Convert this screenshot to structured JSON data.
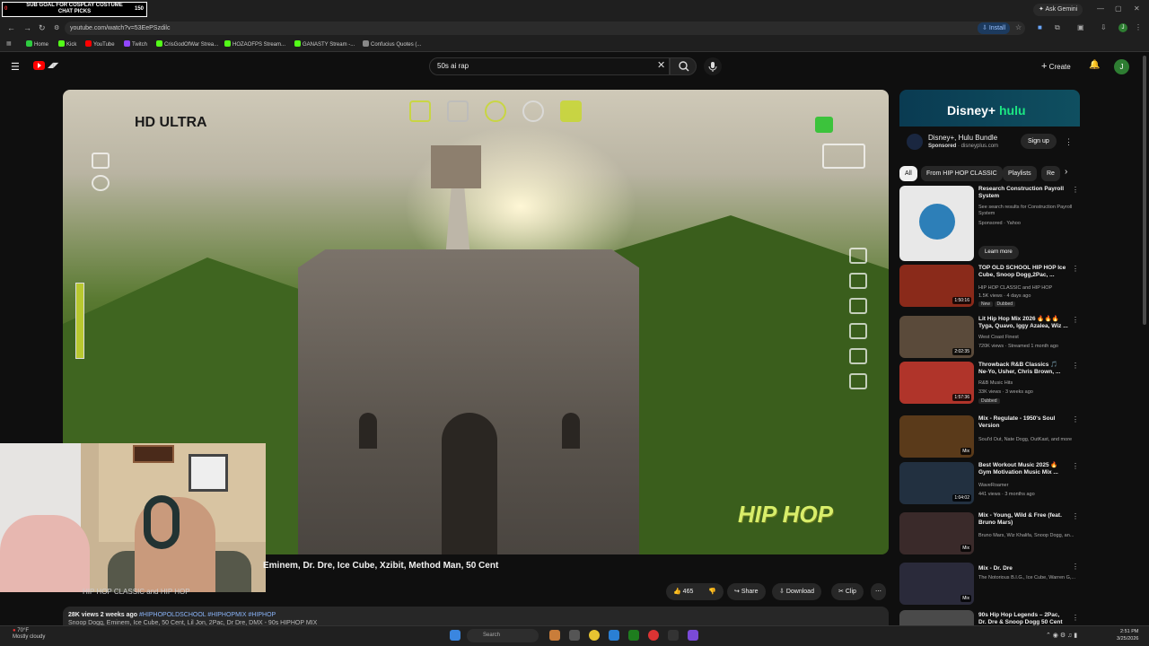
{
  "overlay": {
    "goal_line1": "SUB GOAL FOR COSPLAY COSTUME",
    "goal_line2": "CHAT PICKS",
    "goal_count": "150",
    "goal_live": "0"
  },
  "browser": {
    "ask_gemini": "Ask Gemini",
    "url": "youtube.com/watch?v=53EePSzdilc",
    "install": "Install",
    "bookmarks": [
      {
        "label": "Home",
        "color": "#2ecc40"
      },
      {
        "label": "Kick",
        "color": "#53fc18"
      },
      {
        "label": "YouTube",
        "color": "#ff0000"
      },
      {
        "label": "Twitch",
        "color": "#9146ff"
      },
      {
        "label": "CrisGodOfWar Strea...",
        "color": "#53fc18"
      },
      {
        "label": "HOZAOFPS Stream...",
        "color": "#53fc18"
      },
      {
        "label": "GANASTY Stream -...",
        "color": "#53fc18"
      },
      {
        "label": "Confucius Quotes (...",
        "color": "#888888"
      }
    ]
  },
  "youtube": {
    "search_value": "50s ai rap",
    "create": "Create",
    "avatar_letter": "J"
  },
  "player": {
    "hd_hd": "HD",
    "hd_ultra": " ULTRA",
    "overlay_text": "HIP HOP"
  },
  "video": {
    "title": "Eminem, Dr. Dre, Ice Cube, Xzibit, Method Man, 50 Cent",
    "channel": "HIP HOP CLASSIC and HIP HOP",
    "likes": "465",
    "share": "Share",
    "download": "Download",
    "clip": "Clip",
    "stats": "28K views  2 weeks ago",
    "tags": "#HIPHOPOLDSCHOOL #HIPHOPMIX #HIPHOP",
    "desc": "Snoop Dogg, Eminem, Ice Cube, 50 Cent, Lil Jon, 2Pac, Dr Dre, DMX - 90s HIPHOP MIX"
  },
  "sidebar": {
    "ad": {
      "banner_disney": "Disney+",
      "banner_hulu": " hulu",
      "title": "Disney+, Hulu Bundle",
      "sponsored": "Sponsored",
      "domain": " · disneyplus.com",
      "signup": "Sign up"
    },
    "chips": [
      "All",
      "From HIP HOP CLASSIC",
      "Playlists",
      "Re"
    ],
    "recs": [
      {
        "title": "Research Construction Payroll System",
        "line1": "See search results for Construction Payroll System",
        "line2": "Sponsored · Yahoo",
        "learn_more": "Learn more",
        "thumb": "#2d6b3a",
        "duration": ""
      },
      {
        "title": "TOP OLD SCHOOL HIP HOP Ice Cube, Snoop Dogg,2Pac, ...",
        "line1": "HIP HOP CLASSIC and HIP HOP",
        "line2": "1.5K views · 4 days ago",
        "badges": [
          "New",
          "Dubbed"
        ],
        "thumb": "#8a2a1a",
        "duration": "1:50:16"
      },
      {
        "title": "Lit Hip Hop Mix 2026 🔥🔥🔥 Tyga, Quavo, Iggy Azalea, Wiz ...",
        "line1": "West Coast Finest",
        "line2": "720K views · Streamed 1 month ago",
        "thumb": "#5a4a3a",
        "duration": "2:02:35"
      },
      {
        "title": "Throwback R&B Classics 🎵 Ne-Yo, Usher, Chris Brown, ...",
        "line1": "R&B Music Hits",
        "line2": "33K views · 3 weeks ago",
        "badges": [
          "Dubbed"
        ],
        "thumb": "#b0342a",
        "duration": "1:57:36"
      },
      {
        "title": "Mix - Regulate - 1950's Soul Version",
        "line1": "Soul'd Out, Nate Dogg, OutKast, and more",
        "line2": "",
        "thumb": "#5a3a1a",
        "duration": "Mix"
      },
      {
        "title": "Best Workout Music 2025 🔥 Gym Motivation Music Mix ...",
        "line1": "WaveRoamer",
        "line2": "441 views · 3 months ago",
        "thumb": "#223040",
        "duration": "1:04:02"
      },
      {
        "title": "Mix - Young, Wild & Free (feat. Bruno Mars)",
        "line1": "Bruno Mars, Wiz Khalifa, Snoop Dogg, an...",
        "line2": "",
        "thumb": "#3a2a2a",
        "duration": "Mix"
      },
      {
        "title": "Mix - Dr. Dre",
        "line1": "The Notorious B.I.G., Ice Cube, Warren G,...",
        "line2": "",
        "thumb": "#2a2a3a",
        "duration": "Mix"
      },
      {
        "title": "90s Hip Hop Legends – 2Pac, Dr. Dre & Snoop Dogg 50 Cent",
        "line1": "",
        "line2": "",
        "thumb": "#4a4a4a",
        "duration": ""
      }
    ]
  },
  "taskbar": {
    "weather_temp": "70°F",
    "weather_desc": "Mostly cloudy",
    "search": "Search",
    "time": "2:51 PM",
    "date": "3/25/2026"
  }
}
